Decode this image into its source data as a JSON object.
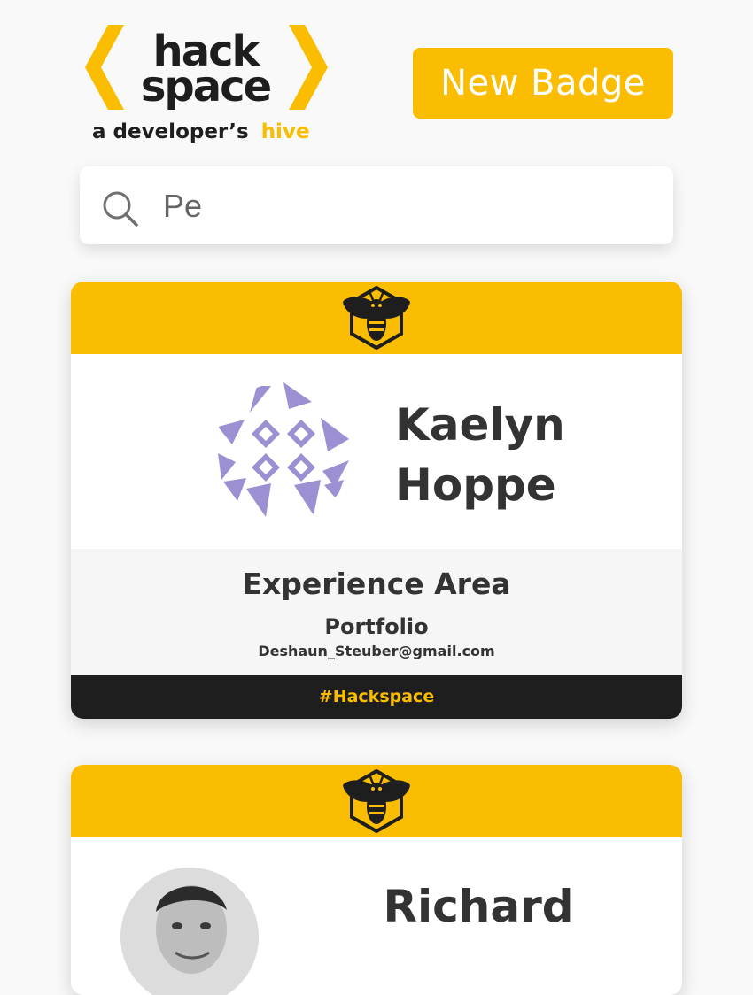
{
  "header": {
    "logo": {
      "line1": "hack",
      "line2": "space",
      "tagline_prefix": "a developer’s",
      "tagline_highlight": "hive"
    },
    "new_badge_label": "New Badge"
  },
  "search": {
    "value": "Pe",
    "icon": "search-icon"
  },
  "cards": [
    {
      "first_name": "Kaelyn",
      "last_name": "Hoppe",
      "experience_label": "Experience Area",
      "portfolio_label": "Portfolio",
      "email": "Deshaun_Steuber@gmail.com",
      "footer": "#Hackspace",
      "avatar": "identicon-avatar"
    },
    {
      "first_name": "Richard",
      "avatar": "photo-avatar"
    }
  ],
  "colors": {
    "accent": "#fbbd01",
    "dark": "#1e1e1e",
    "text": "#333333",
    "identicon": "#9c8fd2",
    "background": "#f9f9f9"
  }
}
